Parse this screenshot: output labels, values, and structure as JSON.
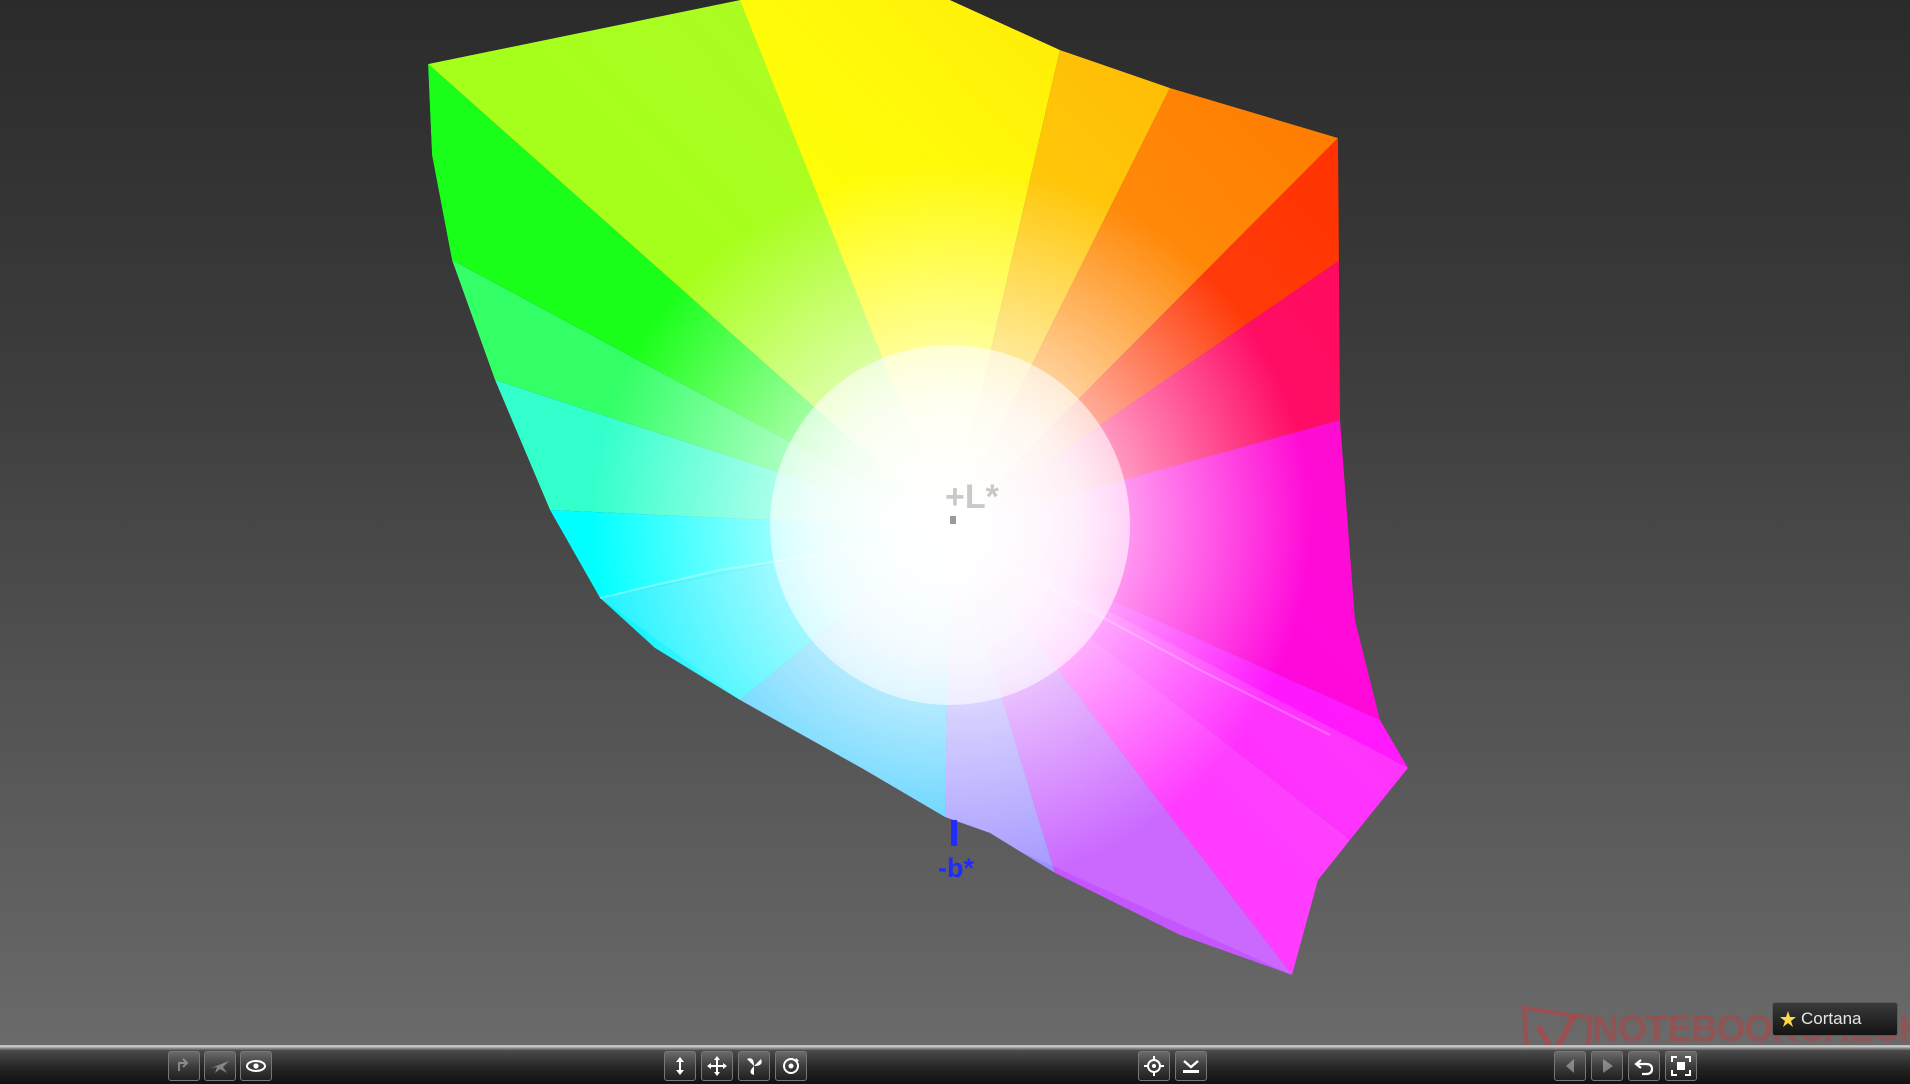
{
  "viewer": {
    "axis_labels": {
      "lightness": "+L*",
      "b_negative": "-b*"
    },
    "colors": {
      "background_top": "#2b2b2b",
      "background_bottom": "#6a6a6a",
      "b_axis": "#1f2bff",
      "l_axis": "#c9c9c9"
    }
  },
  "watermark": {
    "text": "NOTEBOOKCHECK"
  },
  "brand_badge": {
    "text": "Cortana"
  },
  "toolbar": {
    "left_group": [
      {
        "name": "rotate-left-icon",
        "state": "disabled"
      },
      {
        "name": "airplane-icon",
        "state": "disabled"
      },
      {
        "name": "eye-icon",
        "state": "enabled"
      }
    ],
    "center_group": [
      {
        "name": "move-vertical-icon",
        "state": "enabled"
      },
      {
        "name": "move-all-icon",
        "state": "enabled"
      },
      {
        "name": "fan-rotate-icon",
        "state": "enabled"
      },
      {
        "name": "orbit-icon",
        "state": "enabled"
      }
    ],
    "right_center_group": [
      {
        "name": "crosshair-target-icon",
        "state": "enabled"
      },
      {
        "name": "floor-snap-icon",
        "state": "enabled"
      }
    ],
    "right_group": [
      {
        "name": "back-icon",
        "state": "disabled"
      },
      {
        "name": "play-icon",
        "state": "disabled"
      },
      {
        "name": "undo-icon",
        "state": "enabled"
      },
      {
        "name": "fit-screen-icon",
        "state": "enabled"
      }
    ]
  }
}
